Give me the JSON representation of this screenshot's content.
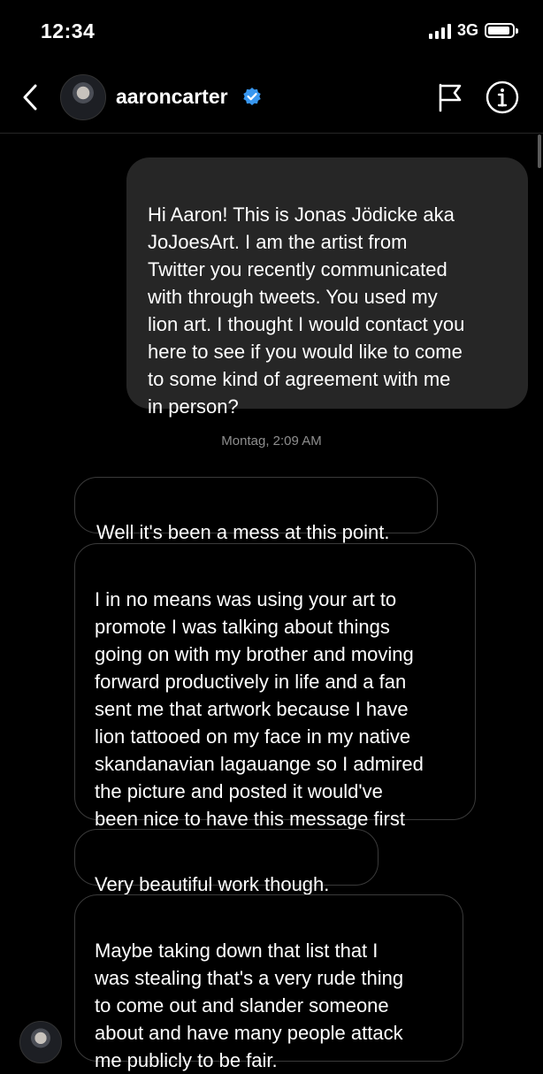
{
  "status_bar": {
    "time": "12:34",
    "network": "3G"
  },
  "header": {
    "back_icon": "chevron-left-icon",
    "username": "aaroncarter",
    "verified_icon": "verified-badge-icon",
    "verified_color": "#3897f0",
    "flag_icon": "flag-icon",
    "info_icon": "info-icon"
  },
  "messages": [
    {
      "direction": "sent",
      "text": "Hi Aaron! This is Jonas Jödicke aka\nJoJoesArt. I am the artist from\nTwitter you recently communicated\nwith through tweets. You used my\nlion art. I thought I would contact you\nhere to see if you would like to come\nto some kind of agreement with me\nin person?"
    },
    {
      "direction": "received",
      "text": "Well it's been a mess at this point."
    },
    {
      "direction": "received",
      "text": "I in no means was using your art to\npromote I was talking about things\ngoing on with my brother and moving\nforward productively in life and a fan\nsent me that artwork because I have\nlion tattooed on my face in my native\nskandanavian lagauange so I admired\nthe picture and posted it  would've\nbeen nice to have this message first"
    },
    {
      "direction": "received",
      "text": "Very beautiful work though."
    },
    {
      "direction": "received",
      "text": "Maybe taking down that list that I\nwas stealing that's a very rude thing\nto come out and slander someone\nabout and have many people attack\nme publicly to be fair."
    }
  ],
  "timestamp": "Montag, 2:09 AM",
  "colors": {
    "background": "#000000",
    "sent_bubble": "#262626",
    "received_border": "#3a3a3a",
    "timestamp_text": "#8e8e8e"
  }
}
